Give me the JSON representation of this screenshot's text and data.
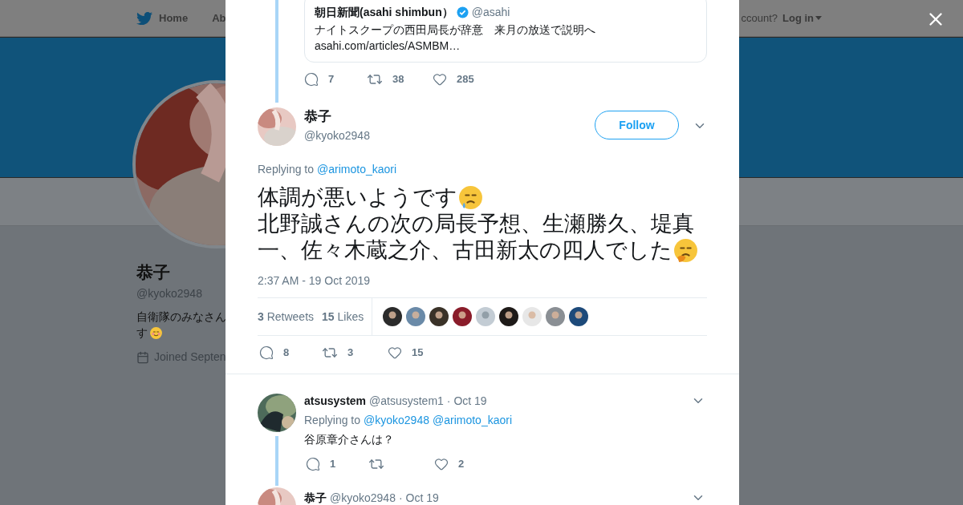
{
  "background_page": {
    "nav": [
      {
        "label": "Home",
        "kind": "home"
      },
      {
        "label": "Ab",
        "kind": "plain"
      }
    ],
    "login_prompt": "ccount?",
    "login_link": "Log in",
    "profile": {
      "name": "恭子",
      "handle": "@kyoko2948",
      "bio_lines": [
        "自衛隊のみなさん",
        "す"
      ],
      "joined": "Joined Septen"
    }
  },
  "quoted_tweet": {
    "name": "朝日新聞(asahi shimbun）",
    "verified": true,
    "handle": "@asahi",
    "text": "ナイトスクープの西田局長が辞意　来月の放送で説明へ",
    "link": "asahi.com/articles/ASMBM…",
    "replies": "7",
    "retweets": "38",
    "likes": "285"
  },
  "tweet": {
    "name": "恭子",
    "handle": "@kyoko2948",
    "follow_label": "Follow",
    "replying_label": "Replying to",
    "replying_to": [
      "@arimoto_kaori"
    ],
    "text_lines": [
      "体調が悪いようです",
      "北野誠さんの次の局長予想、生瀬勝久、堤真",
      "一、佐々木蔵之介、古田新太の四人でした"
    ],
    "timestamp": "2:37 AM - 19 Oct 2019",
    "retweet_count": "3",
    "retweet_label": "Retweets",
    "like_count": "15",
    "like_label": "Likes",
    "replies": "8",
    "retweets": "3",
    "likes": "15"
  },
  "replies": [
    {
      "name": "atsusystem",
      "handle": "@atsusystem1",
      "date": "· Oct 19",
      "replying_label": "Replying to",
      "replying_to": [
        "@kyoko2948",
        "@arimoto_kaori"
      ],
      "text": "谷原章介さんは？",
      "replies": "1",
      "likes": "2"
    },
    {
      "name": "恭子",
      "handle": "@kyoko2948",
      "date": "· Oct 19"
    }
  ]
}
